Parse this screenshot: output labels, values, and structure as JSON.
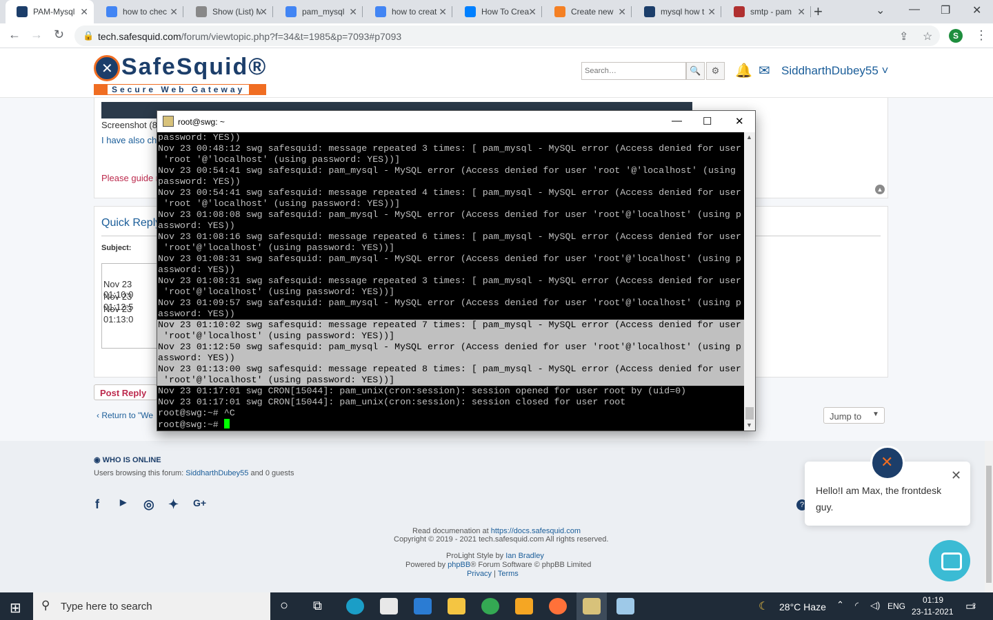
{
  "browser": {
    "tabs": [
      {
        "label": "PAM-Mysql",
        "color": "#1c3e6a"
      },
      {
        "label": "how to chec",
        "color": "#4285f4"
      },
      {
        "label": "Show (List) M",
        "color": "#888888"
      },
      {
        "label": "pam_mysql",
        "color": "#4285f4"
      },
      {
        "label": "how to creat",
        "color": "#4285f4"
      },
      {
        "label": "How To Crea",
        "color": "#0080ff"
      },
      {
        "label": "Create new",
        "color": "#f48024"
      },
      {
        "label": "mysql how t",
        "color": "#1c3e6a"
      },
      {
        "label": "smtp - pam",
        "color": "#b03030"
      }
    ],
    "new_tab": "+",
    "url_host": "tech.safesquid.com",
    "url_path": "/forum/viewtopic.php?f=34&t=1985&p=7093#p7093",
    "profile_initial": "S"
  },
  "site": {
    "logo_name": "SafeSquid®",
    "logo_tagline": "Secure Web Gateway",
    "search_placeholder": "Search…",
    "username": "SiddharthDubey55 ˅"
  },
  "post": {
    "screenshot_label": "Screenshot (8",
    "also_text": "I have also che",
    "guide_text": "Please guide n"
  },
  "quick_reply": {
    "title": "Quick Reply",
    "subject_label": "Subject:",
    "lines": [
      "Nov 23 01:10:0",
      "Nov 23 01:12:5",
      "Nov 23 01:13:0"
    ],
    "post_reply": "Post Reply",
    "return_link": "Return to \"We",
    "jump_to": "Jump to"
  },
  "terminal": {
    "title": "root@swg: ~",
    "lines": [
      {
        "t": "password: YES))",
        "sel": false
      },
      {
        "t": "Nov 23 00:48:12 swg safesquid: message repeated 3 times: [ pam_mysql - MySQL error (Access denied for user",
        "sel": false
      },
      {
        "t": " 'root '@'localhost' (using password: YES))]",
        "sel": false
      },
      {
        "t": "Nov 23 00:54:41 swg safesquid: pam_mysql - MySQL error (Access denied for user 'root '@'localhost' (using",
        "sel": false
      },
      {
        "t": "password: YES))",
        "sel": false
      },
      {
        "t": "Nov 23 00:54:41 swg safesquid: message repeated 4 times: [ pam_mysql - MySQL error (Access denied for user",
        "sel": false
      },
      {
        "t": " 'root '@'localhost' (using password: YES))]",
        "sel": false
      },
      {
        "t": "Nov 23 01:08:08 swg safesquid: pam_mysql - MySQL error (Access denied for user 'root'@'localhost' (using p",
        "sel": false
      },
      {
        "t": "assword: YES))",
        "sel": false
      },
      {
        "t": "Nov 23 01:08:16 swg safesquid: message repeated 6 times: [ pam_mysql - MySQL error (Access denied for user",
        "sel": false
      },
      {
        "t": " 'root'@'localhost' (using password: YES))]",
        "sel": false
      },
      {
        "t": "Nov 23 01:08:31 swg safesquid: pam_mysql - MySQL error (Access denied for user 'root'@'localhost' (using p",
        "sel": false
      },
      {
        "t": "assword: YES))",
        "sel": false
      },
      {
        "t": "Nov 23 01:08:31 swg safesquid: message repeated 3 times: [ pam_mysql - MySQL error (Access denied for user",
        "sel": false
      },
      {
        "t": " 'root'@'localhost' (using password: YES))]",
        "sel": false
      },
      {
        "t": "Nov 23 01:09:57 swg safesquid: pam_mysql - MySQL error (Access denied for user 'root'@'localhost' (using p",
        "sel": false
      },
      {
        "t": "assword: YES))",
        "sel": false
      },
      {
        "t": "Nov 23 01:10:02 swg safesquid: message repeated 7 times: [ pam_mysql - MySQL error (Access denied for user",
        "sel": true
      },
      {
        "t": " 'root'@'localhost' (using password: YES))]",
        "sel": true
      },
      {
        "t": "Nov 23 01:12:50 swg safesquid: pam_mysql - MySQL error (Access denied for user 'root'@'localhost' (using p",
        "sel": true
      },
      {
        "t": "assword: YES))",
        "sel": true
      },
      {
        "t": "Nov 23 01:13:00 swg safesquid: message repeated 8 times: [ pam_mysql - MySQL error (Access denied for user",
        "sel": true
      },
      {
        "t": " 'root'@'localhost' (using password: YES))]",
        "sel": true
      },
      {
        "t": "Nov 23 01:17:01 swg CRON[15044]: pam_unix(cron:session): session opened for user root by (uid=0)",
        "sel": false
      },
      {
        "t": "Nov 23 01:17:01 swg CRON[15044]: pam_unix(cron:session): session closed for user root",
        "sel": false
      },
      {
        "t": "root@swg:~# ^C",
        "sel": false
      }
    ],
    "prompt": "root@swg:~# "
  },
  "footer": {
    "who_title": "WHO IS ONLINE",
    "who_text": "Users browsing this forum: ",
    "who_user": "SiddharthDubey55",
    "who_tail": " and 0 guests",
    "doc_text": "Read documenation at ",
    "doc_link": "https://docs.safesquid.com",
    "copyright": "Copyright © 2019 - 2021 tech.safesquid.com All rights reserved.",
    "style_text": "ProLight Style by ",
    "style_author": "Ian Bradley",
    "powered_text": "Powered by ",
    "powered_link": "phpBB",
    "powered_tail": "® Forum Software © phpBB Limited",
    "privacy": "Privacy",
    "terms": "Terms"
  },
  "chat": {
    "greeting": "Hello!I am Max, the frontdesk guy."
  },
  "taskbar": {
    "search_placeholder": "Type here to search",
    "weather": "28°C  Haze",
    "lang": "ENG",
    "time": "01:19",
    "date": "23-11-2021",
    "notif_count": "2"
  }
}
